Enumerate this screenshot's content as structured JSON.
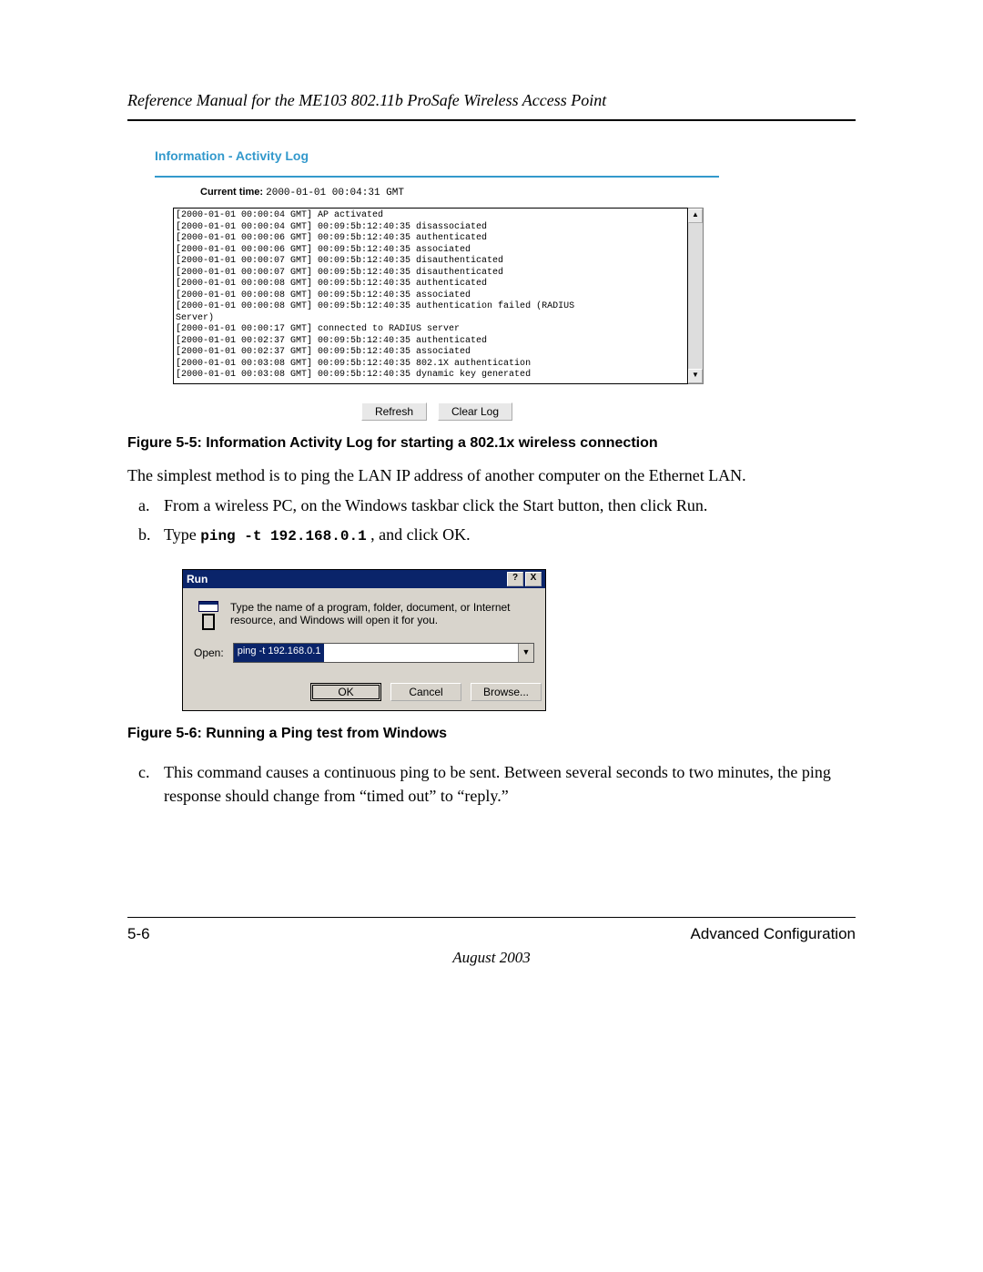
{
  "header": {
    "title": "Reference Manual for the ME103 802.11b ProSafe Wireless Access Point"
  },
  "activity": {
    "panel_title": "Information - Activity Log",
    "current_time_label": "Current time:",
    "current_time_value": "2000-01-01 00:04:31 GMT",
    "log_lines": [
      "[2000-01-01 00:00:04 GMT] AP activated",
      "[2000-01-01 00:00:04 GMT] 00:09:5b:12:40:35 disassociated",
      "[2000-01-01 00:00:06 GMT] 00:09:5b:12:40:35 authenticated",
      "[2000-01-01 00:00:06 GMT] 00:09:5b:12:40:35 associated",
      "[2000-01-01 00:00:07 GMT] 00:09:5b:12:40:35 disauthenticated",
      "[2000-01-01 00:00:07 GMT] 00:09:5b:12:40:35 disauthenticated",
      "[2000-01-01 00:00:08 GMT] 00:09:5b:12:40:35 authenticated",
      "[2000-01-01 00:00:08 GMT] 00:09:5b:12:40:35 associated",
      "[2000-01-01 00:00:08 GMT] 00:09:5b:12:40:35 authentication failed (RADIUS",
      "Server)",
      "[2000-01-01 00:00:17 GMT] connected to RADIUS server",
      "[2000-01-01 00:02:37 GMT] 00:09:5b:12:40:35 authenticated",
      "[2000-01-01 00:02:37 GMT] 00:09:5b:12:40:35 associated",
      "[2000-01-01 00:03:08 GMT] 00:09:5b:12:40:35 802.1X authentication",
      "[2000-01-01 00:03:08 GMT] 00:09:5b:12:40:35 dynamic key generated"
    ],
    "refresh_label": "Refresh",
    "clear_label": "Clear Log"
  },
  "captions": {
    "fig55": "Figure 5-5:  Information Activity Log for starting a 802.1x wireless connection",
    "fig56": "Figure 5-6:  Running a Ping test from Windows"
  },
  "body": {
    "intro": "The simplest method is to ping the LAN IP address of another computer on the Ethernet LAN.",
    "a_mk": "a.",
    "a_text": "From a wireless PC, on the Windows taskbar click the Start button, then click Run.",
    "b_mk": "b.",
    "b_pre": "Type ",
    "b_code": "ping -t 192.168.0.1",
    "b_post": " , and click OK.",
    "c_mk": "c.",
    "c_text": "This command causes a continuous ping to be sent. Between several seconds to two minutes, the ping response should change from “timed out” to “reply.”"
  },
  "run_dialog": {
    "title": "Run",
    "help_btn": "?",
    "close_btn": "X",
    "description": "Type the name of a program, folder, document, or Internet resource, and Windows will open it for you.",
    "open_label": "Open:",
    "open_value": "ping -t 192.168.0.1",
    "ok": "OK",
    "cancel": "Cancel",
    "browse": "Browse..."
  },
  "footer": {
    "page": "5-6",
    "section": "Advanced Configuration",
    "date": "August 2003"
  }
}
